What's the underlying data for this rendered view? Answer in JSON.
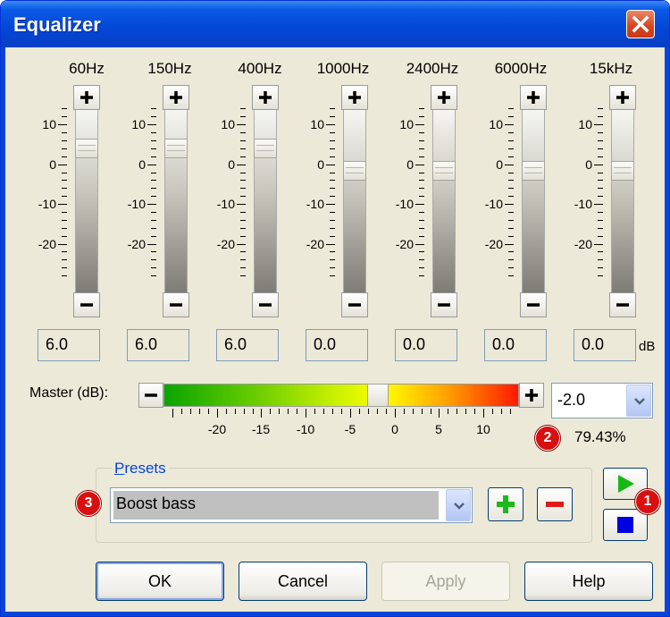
{
  "window": {
    "title": "Equalizer",
    "close_icon": "close-icon"
  },
  "bands": [
    {
      "frequency": "60Hz",
      "value": "6.0",
      "level_db": 6
    },
    {
      "frequency": "150Hz",
      "value": "6.0",
      "level_db": 6
    },
    {
      "frequency": "400Hz",
      "value": "6.0",
      "level_db": 6
    },
    {
      "frequency": "1000Hz",
      "value": "0.0",
      "level_db": 0
    },
    {
      "frequency": "2400Hz",
      "value": "0.0",
      "level_db": 0
    },
    {
      "frequency": "6000Hz",
      "value": "0.0",
      "level_db": 0
    },
    {
      "frequency": "15kHz",
      "value": "0.0",
      "level_db": 0
    }
  ],
  "band_scale": {
    "labels": [
      "10",
      "0",
      "-10",
      "-20"
    ],
    "range_db": [
      -30,
      15
    ]
  },
  "db_unit": "dB",
  "master": {
    "label": "Master (dB):",
    "value": "-2.0",
    "level_db": -2,
    "percent": "79.43%",
    "scale_labels": [
      "-20",
      "-15",
      "-10",
      "-5",
      "0",
      "5",
      "10"
    ],
    "range_db": [
      -26,
      14
    ]
  },
  "presets": {
    "legend": "Presets",
    "legend_underline": "P",
    "legend_rest": "resets",
    "selected": "Boost bass"
  },
  "callouts": [
    "1",
    "2",
    "3"
  ],
  "buttons": {
    "ok": "OK",
    "cancel": "Cancel",
    "apply": "Apply",
    "help": "Help"
  },
  "colors": {
    "title_bar": "#0a5ae6",
    "close_button": "#d8421c",
    "dialog_bg": "#ece9d8",
    "badge": "#d81010",
    "play": "#16b816",
    "stop": "#0000e0",
    "add_preset": "#1db81d",
    "remove_preset": "#e01a1a",
    "legend_text": "#0046d5"
  },
  "icons": {
    "band_increase": "plus-icon",
    "band_decrease": "minus-icon",
    "dropdown": "chevron-down-icon",
    "add_preset": "add-icon",
    "remove_preset": "remove-icon",
    "play": "play-icon",
    "stop": "stop-icon"
  }
}
